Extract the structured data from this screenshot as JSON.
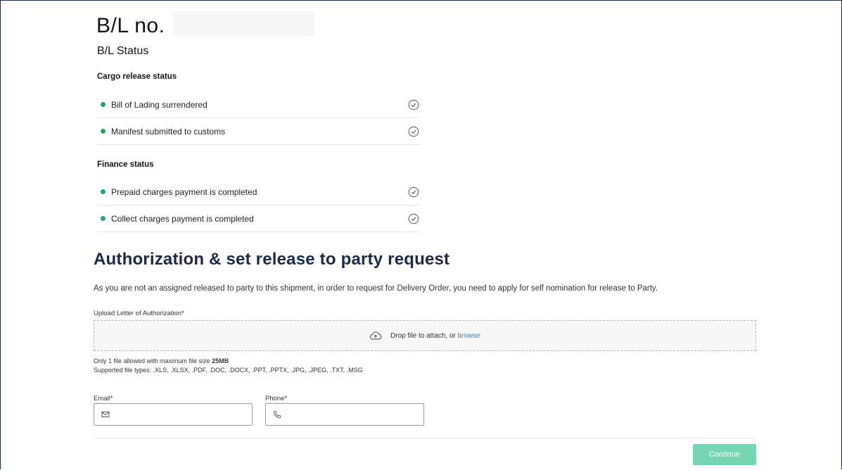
{
  "bl": {
    "title": "B/L no.",
    "status_heading": "B/L Status"
  },
  "cargo": {
    "heading": "Cargo release status",
    "items": [
      {
        "label": "Bill of Lading surrendered"
      },
      {
        "label": "Manifest submitted to customs"
      }
    ]
  },
  "finance": {
    "heading": "Finance status",
    "items": [
      {
        "label": "Prepaid charges payment is completed"
      },
      {
        "label": "Collect charges payment is completed"
      }
    ]
  },
  "auth": {
    "heading": "Authorization & set release to party request",
    "description": "As you are not an assigned released to party to this shipment, in order to request for Delivery Order, you need to apply for self nomination for release to Party."
  },
  "upload": {
    "label": "Upload Letter of Authorization*",
    "drop_text": "Drop file to attach, or",
    "browse_text": "browse",
    "limit_text": "Only 1 file allowed with maximum file size",
    "limit_size": "25MB",
    "types_text": "Supported file types: .XLS, .XLSX, .PDF, .DOC, .DOCX, .PPT, .PPTX, .JPG, .JPEG, .TXT, .MSG"
  },
  "form": {
    "email_label": "Email*",
    "email_value": "",
    "phone_label": "Phone*",
    "phone_value": ""
  },
  "actions": {
    "continue_label": "Continue"
  },
  "colors": {
    "status_dot": "#1ca86b",
    "heading": "#1b2a4a",
    "button": "#74d6b2",
    "link": "#3b78b0"
  },
  "icons": {
    "status_check": "check-circle-icon",
    "upload": "cloud-upload-icon",
    "email": "envelope-icon",
    "phone": "phone-icon"
  }
}
